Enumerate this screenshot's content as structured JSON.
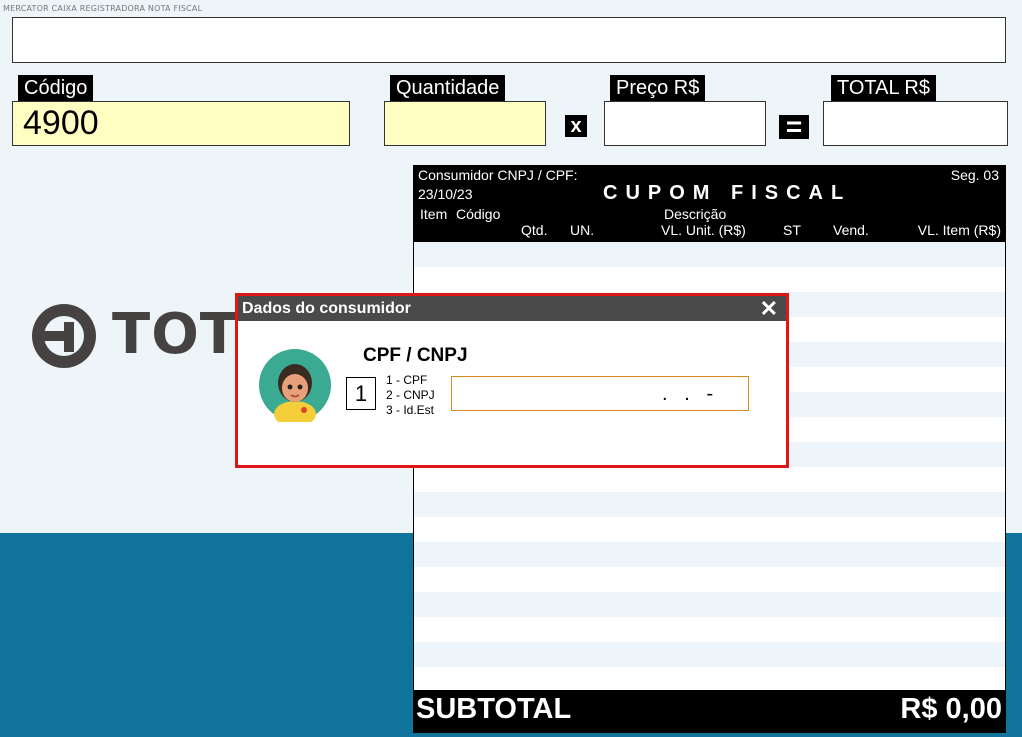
{
  "header": {
    "top_caption": "MERCATOR CAIXA REGISTRADORA NOTA FISCAL"
  },
  "fields": {
    "codigo_label": "Código",
    "codigo_value": "4900",
    "quantidade_label": "Quantidade",
    "quantidade_value": "",
    "times_symbol": "x",
    "preco_label": "Preço R$",
    "preco_value": "",
    "equals_symbol": "=",
    "total_label": "TOTAL R$",
    "total_value": ""
  },
  "logo": {
    "text": "TOTV"
  },
  "receipt": {
    "consumer_label": "Consumidor CNPJ / CPF:",
    "date": "23/10/23",
    "title": "CUPOM FISCAL",
    "seq": "Seg. 03",
    "columns_row1": {
      "item": "Item",
      "codigo": "Código",
      "descricao": "Descrição"
    },
    "columns_row2": {
      "qtd": "Qtd.",
      "un": "UN.",
      "vl_unit": "VL. Unit. (R$)",
      "st": "ST",
      "vend": "Vend.",
      "vl_item": "VL. Item (R$)"
    },
    "subtotal_label": "SUBTOTAL",
    "subtotal_value": "R$ 0,00"
  },
  "dialog": {
    "title": "Dados do consumidor",
    "close_symbol": "✕",
    "heading": "CPF / CNPJ",
    "type_value": "1",
    "options": [
      "1 - CPF",
      "2 - CNPJ",
      "3 - Id.Est"
    ],
    "doc_mask": ".   .   -"
  },
  "colors": {
    "background": "#eef5f8",
    "blue_panel": "#0f739c",
    "yellow_field": "#ffffc4",
    "dialog_border": "#e01515",
    "input_border": "#d9891e"
  }
}
